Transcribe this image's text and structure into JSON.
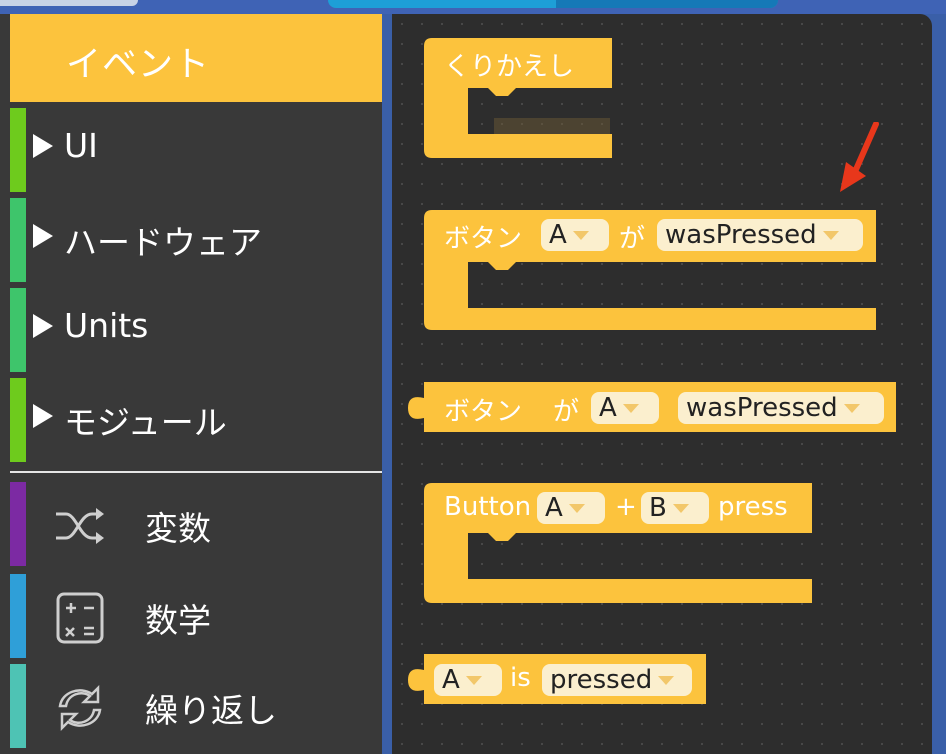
{
  "sidebar": {
    "event": "イベント",
    "items": [
      {
        "label": "UI",
        "color": "#6ecb1d"
      },
      {
        "label": "ハードウェア",
        "color": "#3ec56b"
      },
      {
        "label": "Units",
        "color": "#3ec56b"
      },
      {
        "label": "モジュール",
        "color": "#6ecb1d"
      }
    ],
    "items2": [
      {
        "label": "変数",
        "color": "#7c2aa3",
        "icon": "shuffle-icon"
      },
      {
        "label": "数学",
        "color": "#2f9fd8",
        "icon": "calculator-icon"
      },
      {
        "label": "繰り返し",
        "color": "#4ec3b4",
        "icon": "refresh-icon"
      }
    ]
  },
  "blocks": {
    "repeat": {
      "label": "くりかえし"
    },
    "button_was": {
      "prefix": "ボタン",
      "button": "A",
      "ga": "が",
      "event": "wasPressed"
    },
    "button_was2": {
      "prefix": "ボタン",
      "ga": "が",
      "button": "A",
      "event": "wasPressed"
    },
    "combo": {
      "prefix": "Button",
      "a": "A",
      "plus": "+",
      "b": "B",
      "suffix": "press"
    },
    "is_pressed": {
      "button": "A",
      "is": "is",
      "state": "pressed"
    }
  },
  "colors": {
    "block": "#fcc33d",
    "accent_arrow": "#e8371b"
  }
}
